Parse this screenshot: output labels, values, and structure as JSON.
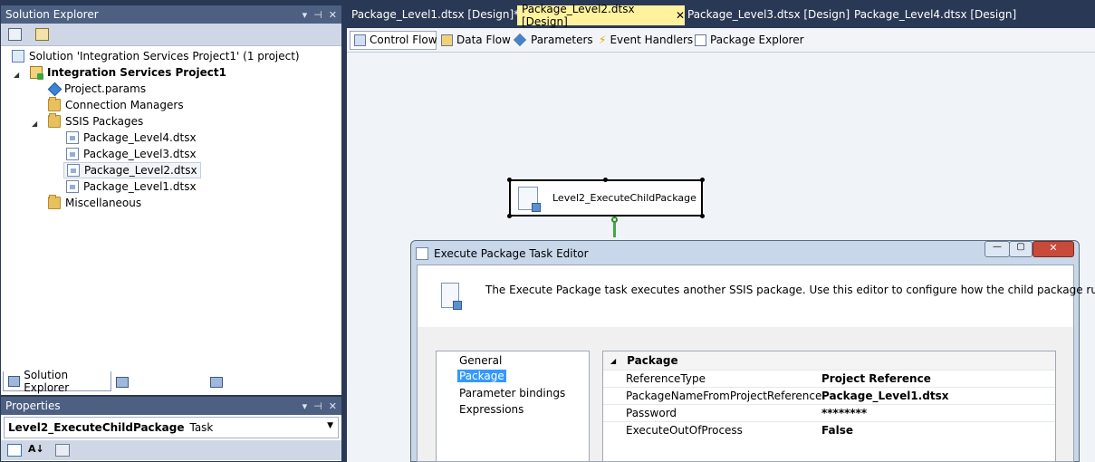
{
  "solution_explorer": {
    "title": "Solution Explorer",
    "controls": [
      "▾",
      "⊣",
      "✕"
    ],
    "tree": [
      {
        "label": "Solution 'Integration Services Project1' (1 project)",
        "icon": "solution-icon"
      },
      {
        "label": "Integration Services Project1",
        "icon": "project-icon"
      },
      {
        "label": "Project.params",
        "icon": "params-icon"
      },
      {
        "label": "Connection Managers",
        "icon": "folder-icon"
      },
      {
        "label": "SSIS Packages",
        "icon": "folder-icon"
      },
      {
        "label": "Package_Level4.dtsx",
        "icon": "package-icon"
      },
      {
        "label": "Package_Level3.dtsx",
        "icon": "package-icon"
      },
      {
        "label": "Package_Level2.dtsx",
        "icon": "package-icon"
      },
      {
        "label": "Package_Level1.dtsx",
        "icon": "package-icon"
      },
      {
        "label": "Miscellaneous",
        "icon": "folder-icon"
      }
    ],
    "bottom_tabs": [
      "Solution Explorer",
      "Team Explorer",
      "Class View"
    ]
  },
  "properties": {
    "title": "Properties",
    "object_name": "Level2_ExecuteChildPackage",
    "object_type": "Task"
  },
  "document_tabs": [
    "Package_Level1.dtsx [Design]*",
    "Package_Level2.dtsx [Design]",
    "Package_Level3.dtsx [Design]",
    "Package_Level4.dtsx [Design]"
  ],
  "designer_tabs": [
    "Control Flow",
    "Data Flow",
    "Parameters",
    "Event Handlers",
    "Package Explorer"
  ],
  "canvas": {
    "task_label": "Level2_ExecuteChildPackage"
  },
  "dialog": {
    "title": "Execute Package Task Editor",
    "description": "The Execute Package task executes another SSIS package. Use this editor to configure how the child package runs.",
    "nav": [
      "General",
      "Package",
      "Parameter bindings",
      "Expressions"
    ],
    "section": "Package",
    "rows": [
      {
        "key": "ReferenceType",
        "value": "Project Reference"
      },
      {
        "key": "PackageNameFromProjectReference",
        "value": "Package_Level1.dtsx"
      },
      {
        "key": "Password",
        "value": "********"
      },
      {
        "key": "ExecuteOutOfProcess",
        "value": "False"
      }
    ]
  },
  "colors": {
    "background": "#293955",
    "panel_title": "#4d6082",
    "active_tab": "#fff29d",
    "selection": "#3399ff"
  }
}
